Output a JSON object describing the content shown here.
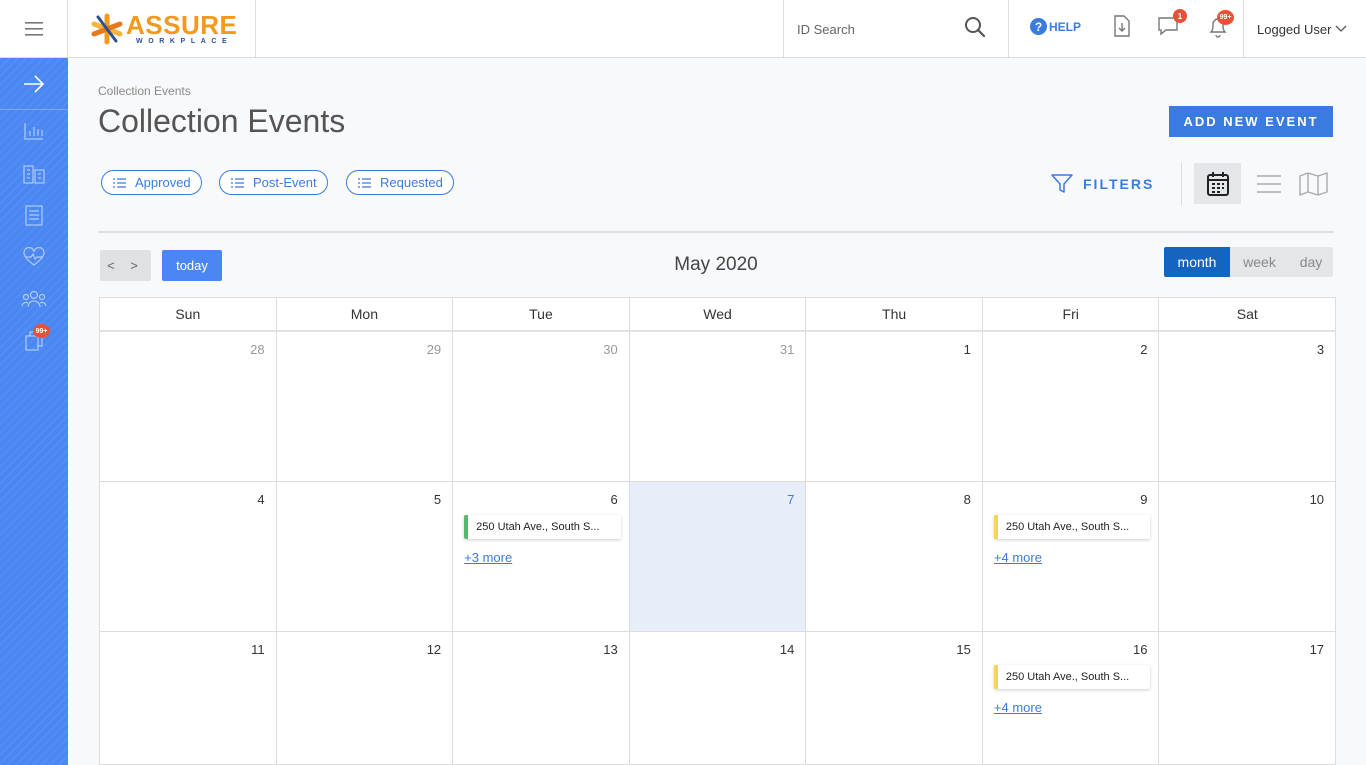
{
  "header": {
    "logo_main": "ASSURE",
    "logo_sub": "WORKPLACE",
    "search_placeholder": "ID Search",
    "help_label": "HELP",
    "messages_badge": "1",
    "alerts_badge": "99+",
    "user_label": "Logged User"
  },
  "sidebar": {
    "items": [
      {
        "icon": "arrow-right-icon"
      },
      {
        "icon": "bar-chart-icon"
      },
      {
        "icon": "building-icon"
      },
      {
        "icon": "document-icon"
      },
      {
        "icon": "heart-pulse-icon"
      },
      {
        "icon": "users-icon"
      },
      {
        "icon": "copy-icon",
        "badge": "99+"
      }
    ]
  },
  "page": {
    "breadcrumb": "Collection Events",
    "title": "Collection Events",
    "add_button": "ADD NEW EVENT",
    "filter_pills": [
      "Approved",
      "Post-Event",
      "Requested"
    ],
    "filters_label": "FILTERS"
  },
  "calendar": {
    "nav_label": "< >",
    "today_label": "today",
    "title": "May 2020",
    "views": [
      "month",
      "week",
      "day"
    ],
    "active_view": "month",
    "weekdays": [
      "Sun",
      "Mon",
      "Tue",
      "Wed",
      "Thu",
      "Fri",
      "Sat"
    ],
    "weeks": [
      [
        {
          "num": "28",
          "other": true
        },
        {
          "num": "29",
          "other": true
        },
        {
          "num": "30",
          "other": true
        },
        {
          "num": "31",
          "other": true
        },
        {
          "num": "1"
        },
        {
          "num": "2"
        },
        {
          "num": "3"
        }
      ],
      [
        {
          "num": "4"
        },
        {
          "num": "5"
        },
        {
          "num": "6",
          "event": "250 Utah Ave., South S...",
          "event_color": "green",
          "more": "+3 more"
        },
        {
          "num": "7",
          "today": true
        },
        {
          "num": "8"
        },
        {
          "num": "9",
          "event": "250 Utah Ave., South S...",
          "event_color": "yellow",
          "more": "+4 more"
        },
        {
          "num": "10"
        }
      ],
      [
        {
          "num": "11"
        },
        {
          "num": "12"
        },
        {
          "num": "13"
        },
        {
          "num": "14"
        },
        {
          "num": "15"
        },
        {
          "num": "16",
          "event": "250 Utah Ave., South S...",
          "event_color": "yellow",
          "more": "+4 more"
        },
        {
          "num": "17"
        }
      ]
    ]
  },
  "colors": {
    "primary": "#3a7be0",
    "sidebar": "#4a87f2",
    "logo_orange": "#f39a1d",
    "event_green": "#58b86c",
    "event_yellow": "#f5d45a"
  }
}
